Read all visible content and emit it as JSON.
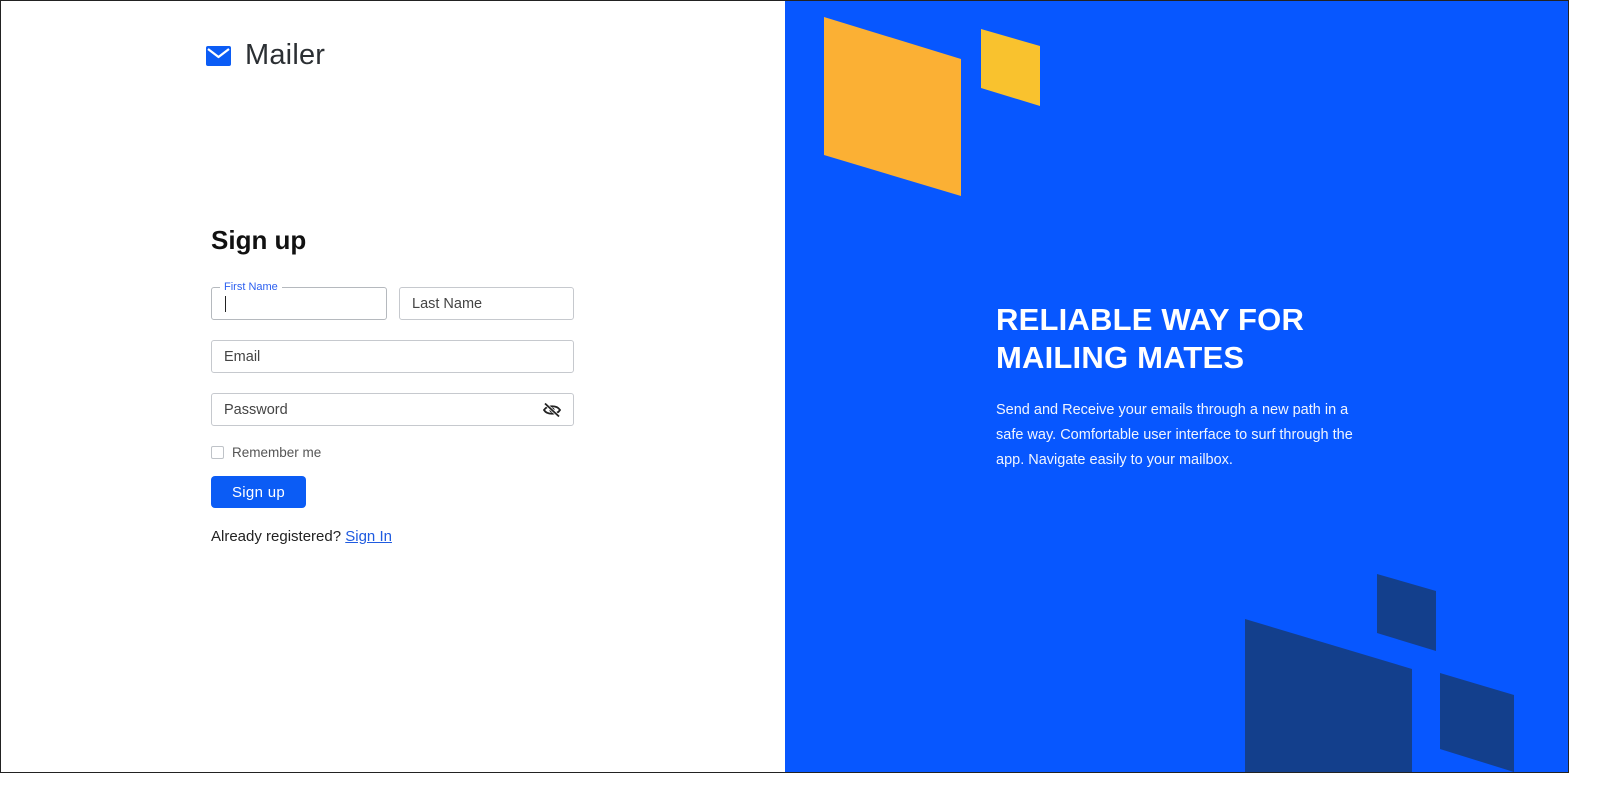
{
  "brand": {
    "name": "Mailer",
    "icon": "envelope-icon"
  },
  "form": {
    "title": "Sign up",
    "first_name": {
      "label": "First Name",
      "value": ""
    },
    "last_name": {
      "placeholder": "Last Name"
    },
    "email": {
      "placeholder": "Email"
    },
    "password": {
      "placeholder": "Password",
      "toggle_icon": "eye-slash-icon"
    },
    "remember_label": "Remember me",
    "remember_checked": false,
    "submit_label": "Sign up",
    "already_text": "Already registered?",
    "signin_label": "Sign In"
  },
  "promo": {
    "headline": "RELIABLE WAY FOR MAILING MATES",
    "description": "Send and Receive your emails through a new path in a safe way. Comfortable user interface to surf through the app. Navigate easily to your mailbox."
  },
  "colors": {
    "accent": "#0b5cf5",
    "panel_bg": "#0757ff",
    "shape_orange": "#fbb034",
    "shape_yellow": "#f9c22e",
    "shape_navy": "#133f8c"
  }
}
